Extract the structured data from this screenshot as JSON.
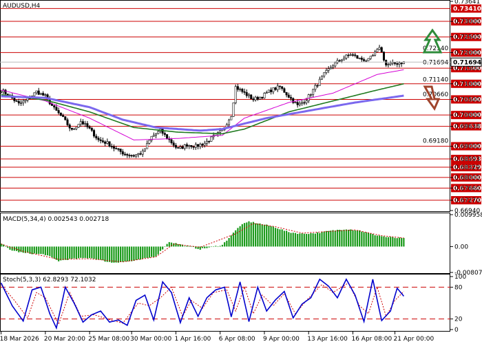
{
  "chart_data": {
    "type": "candlestick",
    "title": "AUDUSD,H4",
    "main": {
      "ylim": [
        0.6694,
        0.7364
      ],
      "y_ticks": [
        "0.73641",
        "0.73000",
        "0.72505",
        "0.72000",
        "0.71500",
        "0.71000",
        "0.70500",
        "0.70000",
        "0.69638",
        "0.69000",
        "0.68593",
        "0.68329",
        "0.68000",
        "0.67660",
        "0.67270",
        "0.66940"
      ],
      "inner_ticks": [
        "0.72140",
        "0.71694",
        "0.71140",
        "0.70660",
        "0.69180"
      ],
      "levels": [
        {
          "value": 0.7341,
          "label": "0.73410"
        },
        {
          "value": 0.73,
          "label": "0.73000"
        },
        {
          "value": 0.725,
          "label": "0.72500"
        },
        {
          "value": 0.72,
          "label": "0.72000"
        },
        {
          "value": 0.715,
          "label": "0.71500"
        },
        {
          "value": 0.71,
          "label": "0.71000"
        },
        {
          "value": 0.705,
          "label": "0.70500"
        },
        {
          "value": 0.7,
          "label": "0.70000"
        },
        {
          "value": 0.69638,
          "label": "0.69638"
        },
        {
          "value": 0.69,
          "label": "0.69000"
        },
        {
          "value": 0.68593,
          "label": "0.68593"
        },
        {
          "value": 0.68329,
          "label": "0.68329"
        },
        {
          "value": 0.68,
          "label": "0.68000"
        },
        {
          "value": 0.6766,
          "label": "0.67660"
        },
        {
          "value": 0.6727,
          "label": "0.67270"
        }
      ],
      "current_price": {
        "value": 0.71694,
        "label": "0.71694"
      },
      "level_color": "#cc0000",
      "up_arrow_color": "#2e8b3a",
      "down_arrow_color": "#a0442c",
      "close_anchors": [
        [
          0,
          0.708
        ],
        [
          4,
          0.706
        ],
        [
          8,
          0.7035
        ],
        [
          12,
          0.705
        ],
        [
          16,
          0.7075
        ],
        [
          20,
          0.706
        ],
        [
          24,
          0.702
        ],
        [
          28,
          0.699
        ],
        [
          32,
          0.695
        ],
        [
          36,
          0.698
        ],
        [
          40,
          0.6955
        ],
        [
          44,
          0.692
        ],
        [
          48,
          0.691
        ],
        [
          52,
          0.689
        ],
        [
          56,
          0.6875
        ],
        [
          60,
          0.687
        ],
        [
          64,
          0.688
        ],
        [
          68,
          0.693
        ],
        [
          72,
          0.695
        ],
        [
          76,
          0.692
        ],
        [
          80,
          0.689
        ],
        [
          84,
          0.6905
        ],
        [
          88,
          0.69
        ],
        [
          92,
          0.691
        ],
        [
          96,
          0.693
        ],
        [
          100,
          0.695
        ],
        [
          104,
          0.7
        ],
        [
          106,
          0.709
        ],
        [
          110,
          0.707
        ],
        [
          114,
          0.705
        ],
        [
          118,
          0.706
        ],
        [
          122,
          0.708
        ],
        [
          126,
          0.709
        ],
        [
          130,
          0.706
        ],
        [
          134,
          0.703
        ],
        [
          138,
          0.705
        ],
        [
          142,
          0.709
        ],
        [
          146,
          0.713
        ],
        [
          150,
          0.716
        ],
        [
          154,
          0.718
        ],
        [
          158,
          0.7195
        ],
        [
          162,
          0.718
        ],
        [
          166,
          0.7175
        ],
        [
          170,
          0.7205
        ],
        [
          171,
          0.722
        ],
        [
          172,
          0.72
        ],
        [
          174,
          0.716
        ],
        [
          178,
          0.7165
        ],
        [
          182,
          0.7169
        ]
      ],
      "candles_count": 183,
      "series": [
        {
          "name": "EMA fast",
          "color": "#d400d4",
          "points": [
            [
              0,
              0.708
            ],
            [
              20,
              0.7045
            ],
            [
              40,
              0.699
            ],
            [
              60,
              0.692
            ],
            [
              80,
              0.6925
            ],
            [
              100,
              0.6935
            ],
            [
              110,
              0.699
            ],
            [
              130,
              0.704
            ],
            [
              150,
              0.707
            ],
            [
              160,
              0.71
            ],
            [
              170,
              0.713
            ],
            [
              182,
              0.7145
            ]
          ]
        },
        {
          "name": "EMA mid",
          "color": "#1f7a1f",
          "points": [
            [
              0,
              0.7065
            ],
            [
              20,
              0.7048
            ],
            [
              40,
              0.701
            ],
            [
              60,
              0.696
            ],
            [
              80,
              0.6945
            ],
            [
              100,
              0.694
            ],
            [
              110,
              0.6955
            ],
            [
              130,
              0.701
            ],
            [
              150,
              0.7045
            ],
            [
              170,
              0.708
            ],
            [
              182,
              0.71
            ]
          ]
        },
        {
          "name": "EMA slow",
          "color": "#7b68ee",
          "points": [
            [
              0,
              0.706
            ],
            [
              20,
              0.7055
            ],
            [
              40,
              0.7025
            ],
            [
              55,
              0.6985
            ],
            [
              70,
              0.696
            ],
            [
              90,
              0.695
            ],
            [
              100,
              0.6955
            ],
            [
              120,
              0.699
            ],
            [
              140,
              0.7015
            ],
            [
              160,
              0.704
            ],
            [
              182,
              0.7062
            ]
          ]
        }
      ]
    },
    "macd": {
      "label": "MACD(5,34,4) 0.002543 0.002718",
      "ylim": [
        -0.008077,
        0.009958
      ],
      "y_ticks": [
        "0.009958",
        "0.00",
        "-0.008077"
      ],
      "bar_color": "#1a9a1a",
      "hist_anchors": [
        [
          0,
          0.001
        ],
        [
          4,
          -0.001
        ],
        [
          10,
          -0.002
        ],
        [
          20,
          -0.0025
        ],
        [
          26,
          -0.0045
        ],
        [
          30,
          -0.004
        ],
        [
          40,
          -0.0035
        ],
        [
          50,
          -0.005
        ],
        [
          60,
          -0.0045
        ],
        [
          70,
          -0.003
        ],
        [
          76,
          0.0015
        ],
        [
          82,
          0.0005
        ],
        [
          90,
          -0.0008
        ],
        [
          100,
          0.0005
        ],
        [
          108,
          0.0065
        ],
        [
          112,
          0.0078
        ],
        [
          118,
          0.007
        ],
        [
          124,
          0.006
        ],
        [
          130,
          0.0045
        ],
        [
          136,
          0.004
        ],
        [
          142,
          0.0042
        ],
        [
          150,
          0.005
        ],
        [
          156,
          0.0055
        ],
        [
          162,
          0.005
        ],
        [
          168,
          0.0038
        ],
        [
          174,
          0.003
        ],
        [
          182,
          0.0025
        ]
      ],
      "signal_anchors": [
        [
          0,
          0.0008
        ],
        [
          10,
          -0.0015
        ],
        [
          26,
          -0.004
        ],
        [
          40,
          -0.0038
        ],
        [
          55,
          -0.0048
        ],
        [
          70,
          -0.0032
        ],
        [
          78,
          0.0008
        ],
        [
          90,
          -0.0002
        ],
        [
          106,
          0.004
        ],
        [
          114,
          0.0072
        ],
        [
          124,
          0.0062
        ],
        [
          136,
          0.0042
        ],
        [
          150,
          0.0048
        ],
        [
          160,
          0.0052
        ],
        [
          172,
          0.0034
        ],
        [
          182,
          0.0027
        ]
      ]
    },
    "stoch": {
      "label": "Stoch(5,3,3) 62.8293 72.1032",
      "ylim": [
        0,
        100
      ],
      "y_ticks": [
        "100",
        "80",
        "20",
        "0"
      ],
      "levels": [
        80,
        20
      ],
      "main_color": "#0000cc",
      "signal_color": "#cc0000",
      "k_anchors": [
        [
          0,
          88
        ],
        [
          5,
          45
        ],
        [
          10,
          16
        ],
        [
          14,
          75
        ],
        [
          18,
          80
        ],
        [
          22,
          30
        ],
        [
          25,
          3
        ],
        [
          29,
          80
        ],
        [
          33,
          50
        ],
        [
          37,
          14
        ],
        [
          41,
          28
        ],
        [
          45,
          35
        ],
        [
          49,
          14
        ],
        [
          53,
          18
        ],
        [
          57,
          8
        ],
        [
          61,
          55
        ],
        [
          65,
          65
        ],
        [
          69,
          18
        ],
        [
          73,
          90
        ],
        [
          77,
          70
        ],
        [
          81,
          13
        ],
        [
          85,
          60
        ],
        [
          89,
          25
        ],
        [
          93,
          60
        ],
        [
          97,
          75
        ],
        [
          101,
          80
        ],
        [
          104,
          24
        ],
        [
          108,
          90
        ],
        [
          112,
          15
        ],
        [
          116,
          80
        ],
        [
          120,
          35
        ],
        [
          124,
          56
        ],
        [
          128,
          72
        ],
        [
          132,
          22
        ],
        [
          136,
          48
        ],
        [
          140,
          60
        ],
        [
          144,
          95
        ],
        [
          148,
          82
        ],
        [
          152,
          60
        ],
        [
          156,
          95
        ],
        [
          160,
          65
        ],
        [
          164,
          15
        ],
        [
          168,
          95
        ],
        [
          172,
          17
        ],
        [
          176,
          35
        ],
        [
          179,
          78
        ],
        [
          182,
          63
        ]
      ],
      "d_anchors": [
        [
          0,
          85
        ],
        [
          6,
          55
        ],
        [
          12,
          22
        ],
        [
          16,
          70
        ],
        [
          20,
          60
        ],
        [
          26,
          10
        ],
        [
          31,
          70
        ],
        [
          36,
          25
        ],
        [
          42,
          28
        ],
        [
          48,
          20
        ],
        [
          55,
          12
        ],
        [
          62,
          50
        ],
        [
          67,
          45
        ],
        [
          72,
          60
        ],
        [
          77,
          80
        ],
        [
          82,
          25
        ],
        [
          86,
          55
        ],
        [
          91,
          40
        ],
        [
          96,
          70
        ],
        [
          102,
          75
        ],
        [
          106,
          35
        ],
        [
          110,
          80
        ],
        [
          114,
          30
        ],
        [
          118,
          65
        ],
        [
          123,
          45
        ],
        [
          128,
          68
        ],
        [
          133,
          30
        ],
        [
          138,
          55
        ],
        [
          145,
          85
        ],
        [
          150,
          70
        ],
        [
          157,
          88
        ],
        [
          162,
          45
        ],
        [
          166,
          30
        ],
        [
          170,
          80
        ],
        [
          174,
          25
        ],
        [
          178,
          55
        ],
        [
          182,
          72
        ]
      ]
    },
    "x_ticks": [
      "18 Mar 2026",
      "20 Mar 20:00",
      "25 Mar 08:00",
      "30 Mar 00:00",
      "1 Apr 16:00",
      "6 Apr 08:00",
      "9 Apr 00:00",
      "13 Apr 16:00",
      "16 Apr 08:00",
      "21 Apr 00:00"
    ]
  }
}
